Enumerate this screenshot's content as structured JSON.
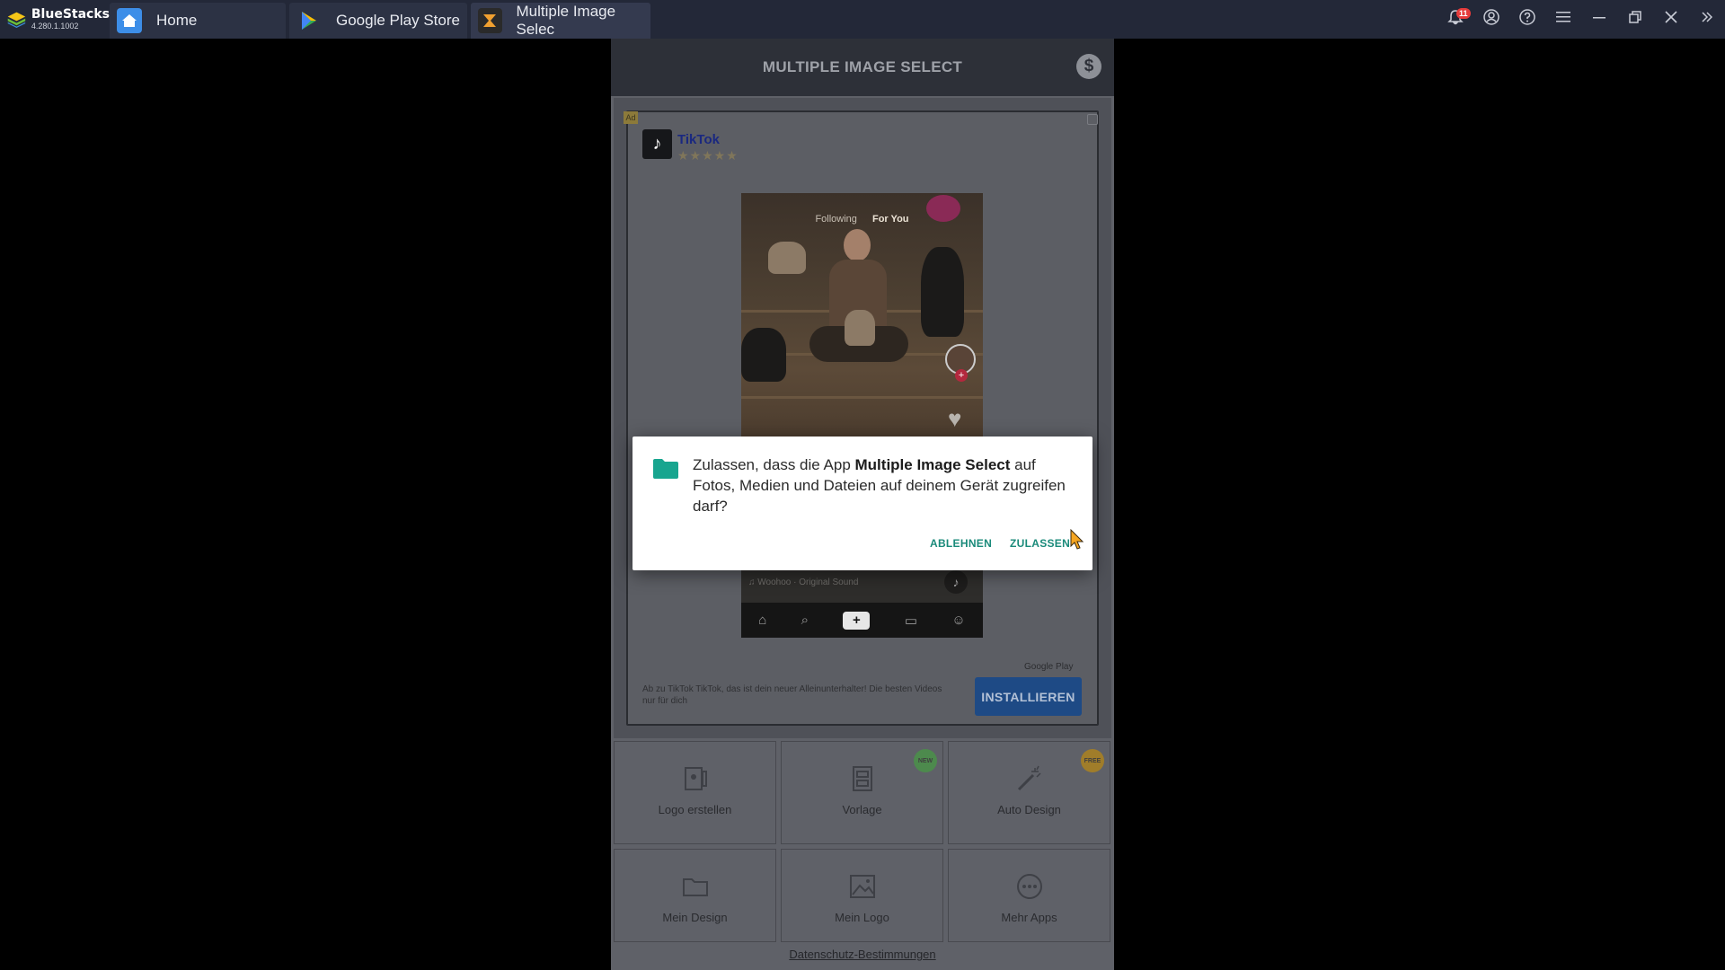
{
  "emulator": {
    "brand": "BlueStacks",
    "version": "4.280.1.1002",
    "notification_count": "11",
    "tabs": [
      {
        "label": "Home",
        "icon": "home-icon"
      },
      {
        "label": "Google Play Store",
        "icon": "play-store-icon"
      },
      {
        "label": "Multiple Image Selec",
        "icon": "app-icon"
      }
    ]
  },
  "app": {
    "title": "MULTIPLE IMAGE SELECT"
  },
  "ad": {
    "label": "Ad",
    "advertiser": "TikTok",
    "rating_stars": "★★★★★",
    "video": {
      "tab_following": "Following",
      "tab_for_you": "For You",
      "sound": "♫ Woohoo · Original Sound"
    },
    "source": "Google Play",
    "description": "Ab zu TikTok TikTok, das ist dein neuer Alleinunterhalter! Die besten Videos nur für dich",
    "install_label": "INSTALLIEREN"
  },
  "tiles": [
    {
      "label": "Logo erstellen",
      "icon": "logo-create-icon",
      "badge": ""
    },
    {
      "label": "Vorlage",
      "icon": "template-icon",
      "badge": "NEW"
    },
    {
      "label": "Auto Design",
      "icon": "magic-wand-icon",
      "badge": "FREE"
    },
    {
      "label": "Mein Design",
      "icon": "folder-icon",
      "badge": ""
    },
    {
      "label": "Mein Logo",
      "icon": "image-icon",
      "badge": ""
    },
    {
      "label": "Mehr Apps",
      "icon": "more-apps-icon",
      "badge": ""
    }
  ],
  "privacy_link": "Datenschutz-Bestimmungen",
  "permission_dialog": {
    "text_before": "Zulassen, dass die App ",
    "app_name": "Multiple Image Select",
    "text_after": " auf Fotos, Medien und Dateien auf deinem Gerät zugreifen darf?",
    "deny_label": "ABLEHNEN",
    "allow_label": "ZULASSEN",
    "accent_color": "#1a8a7a"
  }
}
